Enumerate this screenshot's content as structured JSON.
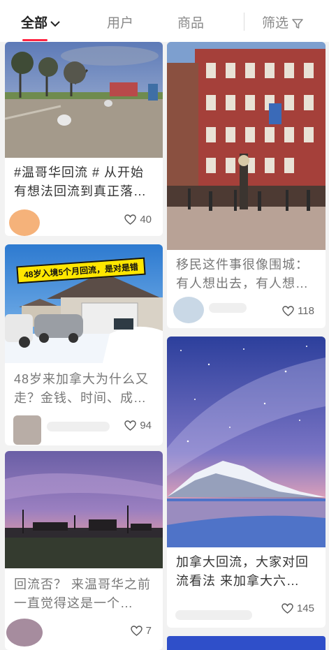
{
  "tabs": {
    "all": "全部",
    "users": "用户",
    "goods": "商品",
    "filter": "筛选"
  },
  "colors": {
    "accent": "#ff2442"
  },
  "cards": [
    {
      "title": "#温哥华回流 # 从开始有想法回流到真正落…",
      "likes": "40"
    },
    {
      "title": "移民这件事很像围城：有人想出去，有人想…",
      "likes": "118"
    },
    {
      "banner": "48岁入境5个月回流，是对是错",
      "title": "48岁来加拿大为什么又走？金钱、时间、成…",
      "likes": "94"
    },
    {
      "title": "加拿大回流，大家对回流看法 来加拿大六…",
      "likes": "145"
    },
    {
      "title": "回流否？ 来温哥华之前一直觉得这是一个…",
      "likes": "7"
    }
  ],
  "icons": {
    "heart": "heart-icon",
    "filter": "filter-icon",
    "dropdown": "chevron-down-icon"
  }
}
